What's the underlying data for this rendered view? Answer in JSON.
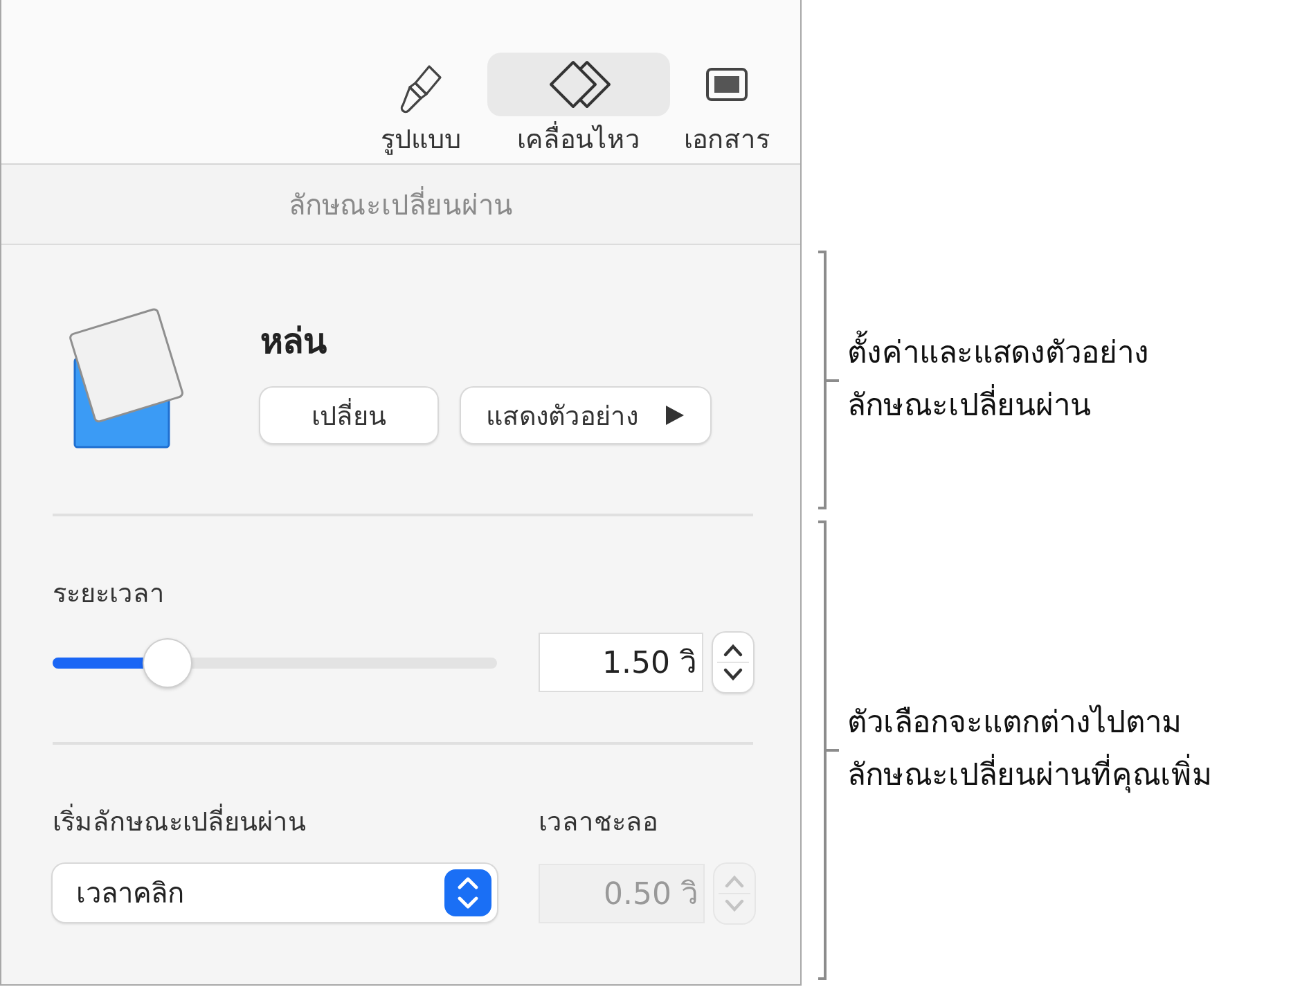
{
  "tabs": [
    {
      "label": "รูปแบบ",
      "kind": "brush",
      "selected": false
    },
    {
      "label": "เคลื่อนไหว",
      "kind": "diamonds",
      "selected": true
    },
    {
      "label": "เอกสาร",
      "kind": "document",
      "selected": false
    }
  ],
  "section_title": "ลักษณะเปลี่ยนผ่าน",
  "transition": {
    "name": "หล่น",
    "buttons": [
      {
        "label": "เปลี่ยน",
        "kind": "plain"
      },
      {
        "label": "แสดงตัวอย่าง",
        "kind": "play"
      }
    ]
  },
  "duration": {
    "label": "ระยะเวลา",
    "level": 0.26,
    "value": "1.50 วิ"
  },
  "start": {
    "label": "เริ่มลักษณะเปลี่ยนผ่าน",
    "value": "เวลาคลิก"
  },
  "delay": {
    "label": "เวลาชะลอ",
    "value": "0.50 วิ",
    "disabled": true
  },
  "callouts": [
    {
      "lines": [
        "ตั้งค่าและแสดงตัวอย่าง",
        "ลักษณะเปลี่ยนผ่าน"
      ]
    },
    {
      "lines": [
        "ตัวเลือกจะแตกต่างไปตาม",
        "ลักษณะเปลี่ยนผ่านที่คุณเพิ่ม"
      ]
    }
  ]
}
